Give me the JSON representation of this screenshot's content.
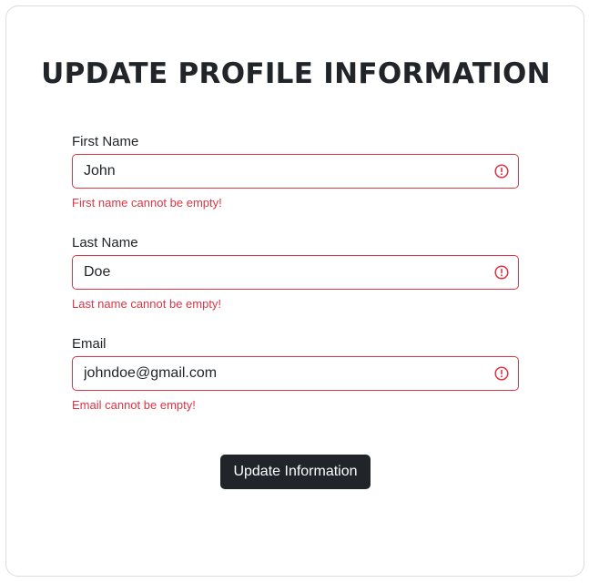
{
  "form": {
    "title": "UPDATE PROFILE INFORMATION",
    "fields": [
      {
        "label": "First Name",
        "value": "John",
        "error": "First name cannot be empty!"
      },
      {
        "label": "Last Name",
        "value": "Doe",
        "error": "Last name cannot be empty!"
      },
      {
        "label": "Email",
        "value": "johndoe@gmail.com",
        "error": "Email cannot be empty!"
      }
    ],
    "submit_label": "Update Information",
    "icon": "exclamation-circle-icon"
  },
  "colors": {
    "error": "#dc3545",
    "text": "#212529",
    "button_bg": "#212529",
    "card_border": "#dcdcdc"
  }
}
